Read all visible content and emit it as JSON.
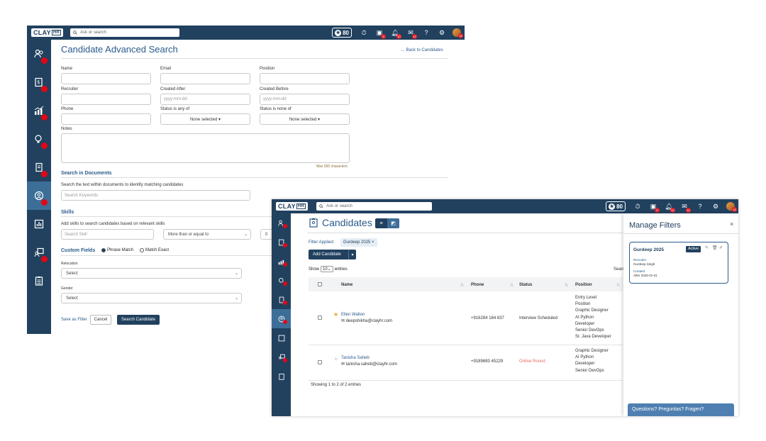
{
  "brand": {
    "name": "CLAY",
    "suffix": "HR"
  },
  "topbar": {
    "search_placeholder": "Ask or search",
    "points": "80",
    "badges": {
      "apps": "9",
      "notifications": "10",
      "messages": "12",
      "avatar": "19"
    }
  },
  "colors": {
    "nav": "#21415f",
    "accent": "#2a5b8c",
    "badge": "#e30613",
    "active_nav": "#3d6e98"
  },
  "advanced_search": {
    "title": "Candidate Advanced Search",
    "back_link": "← Back to Candidates",
    "labels": {
      "name": "Name",
      "email": "Email",
      "position": "Position",
      "recruiter": "Recruiter",
      "created_after": "Created After",
      "created_before": "Created Before",
      "phone": "Phone",
      "status_any": "Status is any of",
      "status_none": "Status is none of",
      "notes": "Notes"
    },
    "date_placeholder": "yyyy-mm-dd",
    "none_selected": "None selected ▾",
    "max_chars": "Max 500 characters",
    "documents": {
      "title": "Search in Documents",
      "description": "Search the text within documents to identify matching candidates",
      "placeholder": "Search Keywords"
    },
    "skills": {
      "title": "Skills",
      "description": "Add skills to search candidates based on relevant skills",
      "placeholder": "Search Skill",
      "comparator": "More than or equal to",
      "level": "0"
    },
    "custom_fields": {
      "title": "Custom Fields",
      "phrase_match": "Phrase Match",
      "match_exact": "Match Exact",
      "relocation_label": "Relocation",
      "gender_label": "Gender",
      "select_placeholder": "Select"
    },
    "actions": {
      "save_filter": "Save as Filter",
      "cancel": "Cancel",
      "search": "Search Candidate"
    }
  },
  "candidates": {
    "title": "Candidates",
    "filter_applied_label": "Filter Applied:",
    "filter_chip": "Gurdeep 2025 ×",
    "add_button": "Add Candidate",
    "show_label": "Show",
    "entries_value": "10",
    "entries_label": "entries",
    "search_label": "Searc",
    "columns": {
      "name": "Name",
      "phone": "Phone",
      "status": "Status",
      "position": "Position"
    },
    "rows": [
      {
        "name": "Ellen Walton",
        "email": "deepshikha@clayhr.com",
        "phone": "+916284 184 837",
        "status": "Interview Scheduled",
        "positions": [
          "Entry Level",
          "Position",
          "Graphic Designer",
          "AI Python",
          "Developer",
          "Senior DevOps",
          "Sr. Java Developer"
        ],
        "starred": true
      },
      {
        "name": "Tanisha Saheb",
        "email": "tanisha.saheb@clayhr.com",
        "phone": "+9189683 45229",
        "status": "Online Round",
        "positions": [
          "Graphic Designer",
          "AI Python",
          "Developer",
          "Senior DevOps"
        ],
        "starred": false
      }
    ],
    "footer": "Showing 1 to 2 of 2 entries"
  },
  "manage_filters": {
    "title": "Manage Filters",
    "close": "×",
    "card": {
      "name": "Gurdeep 2025",
      "status": "Active",
      "recruiter_label": "Recruiter",
      "recruiter": "Gurdeep Singh",
      "created_label": "Created",
      "created": "After 2025-01-01"
    },
    "help": "Questions? Preguntas? Fragen?"
  }
}
